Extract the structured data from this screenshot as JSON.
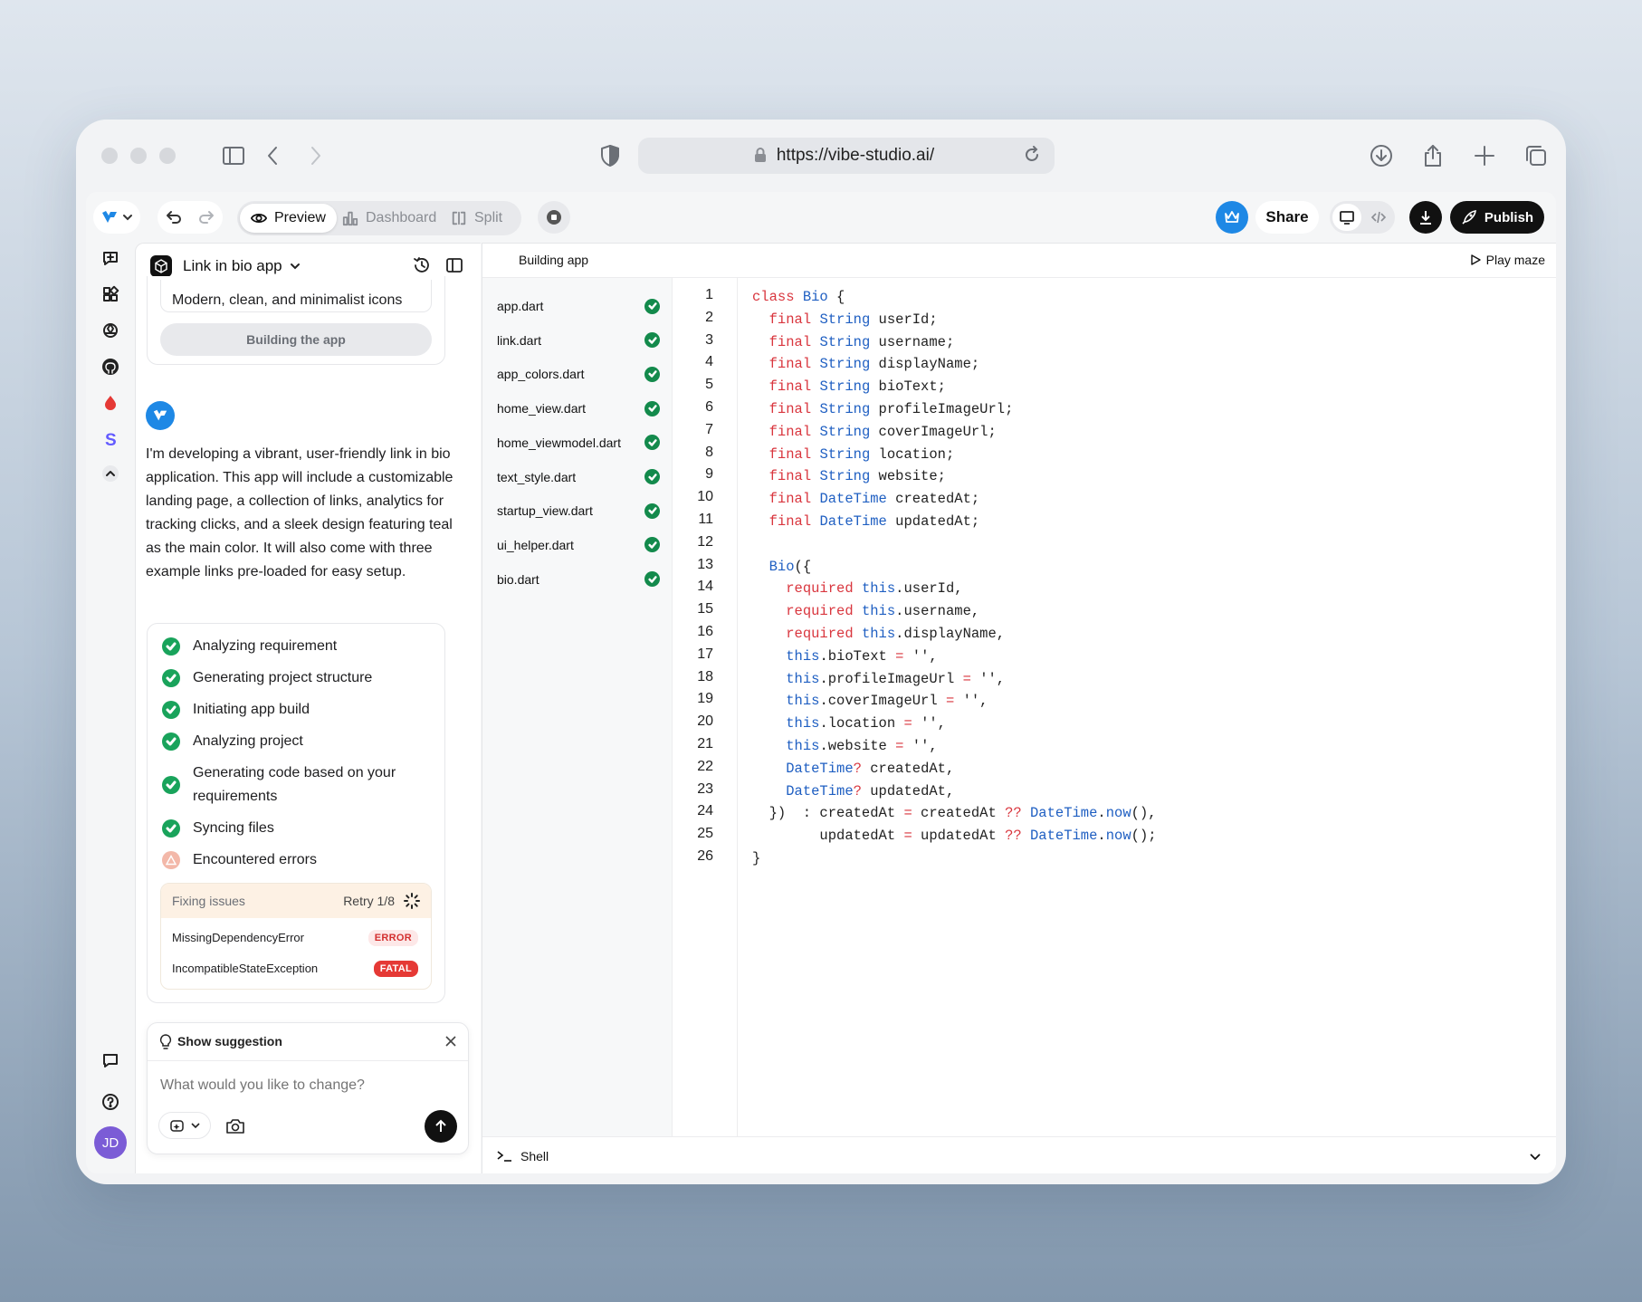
{
  "browser": {
    "url": "https://vibe-studio.ai/"
  },
  "toolbar": {
    "tabs": [
      {
        "label": "Preview",
        "icon": "eye-icon",
        "active": true
      },
      {
        "label": "Dashboard",
        "icon": "bar-chart-icon",
        "active": false
      },
      {
        "label": "Split",
        "icon": "split-icon",
        "active": false
      }
    ],
    "share_label": "Share",
    "publish_label": "Publish"
  },
  "chat": {
    "project_title": "Link in bio app",
    "prev_card": {
      "text": "Modern, clean, and minimalist icons",
      "button": "Building the app"
    },
    "message": "I'm developing a vibrant, user-friendly link in bio application. This app will include a customizable landing page, a collection of links, analytics for tracking clicks, and a sleek design featuring teal as the main color. It will also come with three example links pre-loaded for easy setup.",
    "steps": [
      {
        "label": "Analyzing requirement",
        "status": "done"
      },
      {
        "label": "Generating project structure",
        "status": "done"
      },
      {
        "label": "Initiating app build",
        "status": "done"
      },
      {
        "label": "Analyzing project",
        "status": "done"
      },
      {
        "label": "Generating code based on your requirements",
        "status": "done"
      },
      {
        "label": "Syncing files",
        "status": "done"
      },
      {
        "label": "Encountered errors",
        "status": "error"
      }
    ],
    "fixing": {
      "title": "Fixing issues",
      "retry": "Retry 1/8",
      "errors": [
        {
          "name": "MissingDependencyError",
          "level": "ERROR"
        },
        {
          "name": "IncompatibleStateException",
          "level": "FATAL"
        }
      ]
    },
    "suggestion_label": "Show suggestion",
    "input_placeholder": "What would you like to change?"
  },
  "user": {
    "initials": "JD"
  },
  "editor": {
    "status": "Building app",
    "play_label": "Play maze",
    "files": [
      "app.dart",
      "link.dart",
      "app_colors.dart",
      "home_view.dart",
      "home_viewmodel.dart",
      "text_style.dart",
      "startup_view.dart",
      "ui_helper.dart",
      "bio.dart"
    ],
    "line_numbers": [
      "1",
      "2",
      "3",
      "4",
      "5",
      "6",
      "7",
      "8",
      "9",
      "10",
      "11",
      "12",
      "13",
      "14",
      "15",
      "16",
      "17",
      "18",
      "19",
      "20",
      "21",
      "22",
      "23",
      "24",
      "25",
      "26"
    ],
    "code_lines": [
      "class Bio {",
      "  final String userId;",
      "  final String username;",
      "  final String displayName;",
      "  final String bioText;",
      "  final String profileImageUrl;",
      "  final String coverImageUrl;",
      "  final String location;",
      "  final String website;",
      "  final DateTime createdAt;",
      "  final DateTime updatedAt;",
      "",
      "  Bio({",
      "    required this.userId,",
      "    required this.username,",
      "    required this.displayName,",
      "    this.bioText = '',",
      "    this.profileImageUrl = '',",
      "    this.coverImageUrl = '',",
      "    this.location = '',",
      "    this.website = '',",
      "    DateTime? createdAt,",
      "    DateTime? updatedAt,",
      "  })  : createdAt = createdAt ?? DateTime.now(),",
      "        updatedAt = updatedAt ?? DateTime.now();",
      "}"
    ],
    "shell_label": "Shell"
  },
  "colors": {
    "accent_blue": "#1e88e5",
    "success_green": "#19a35b",
    "error_red": "#e53935"
  }
}
